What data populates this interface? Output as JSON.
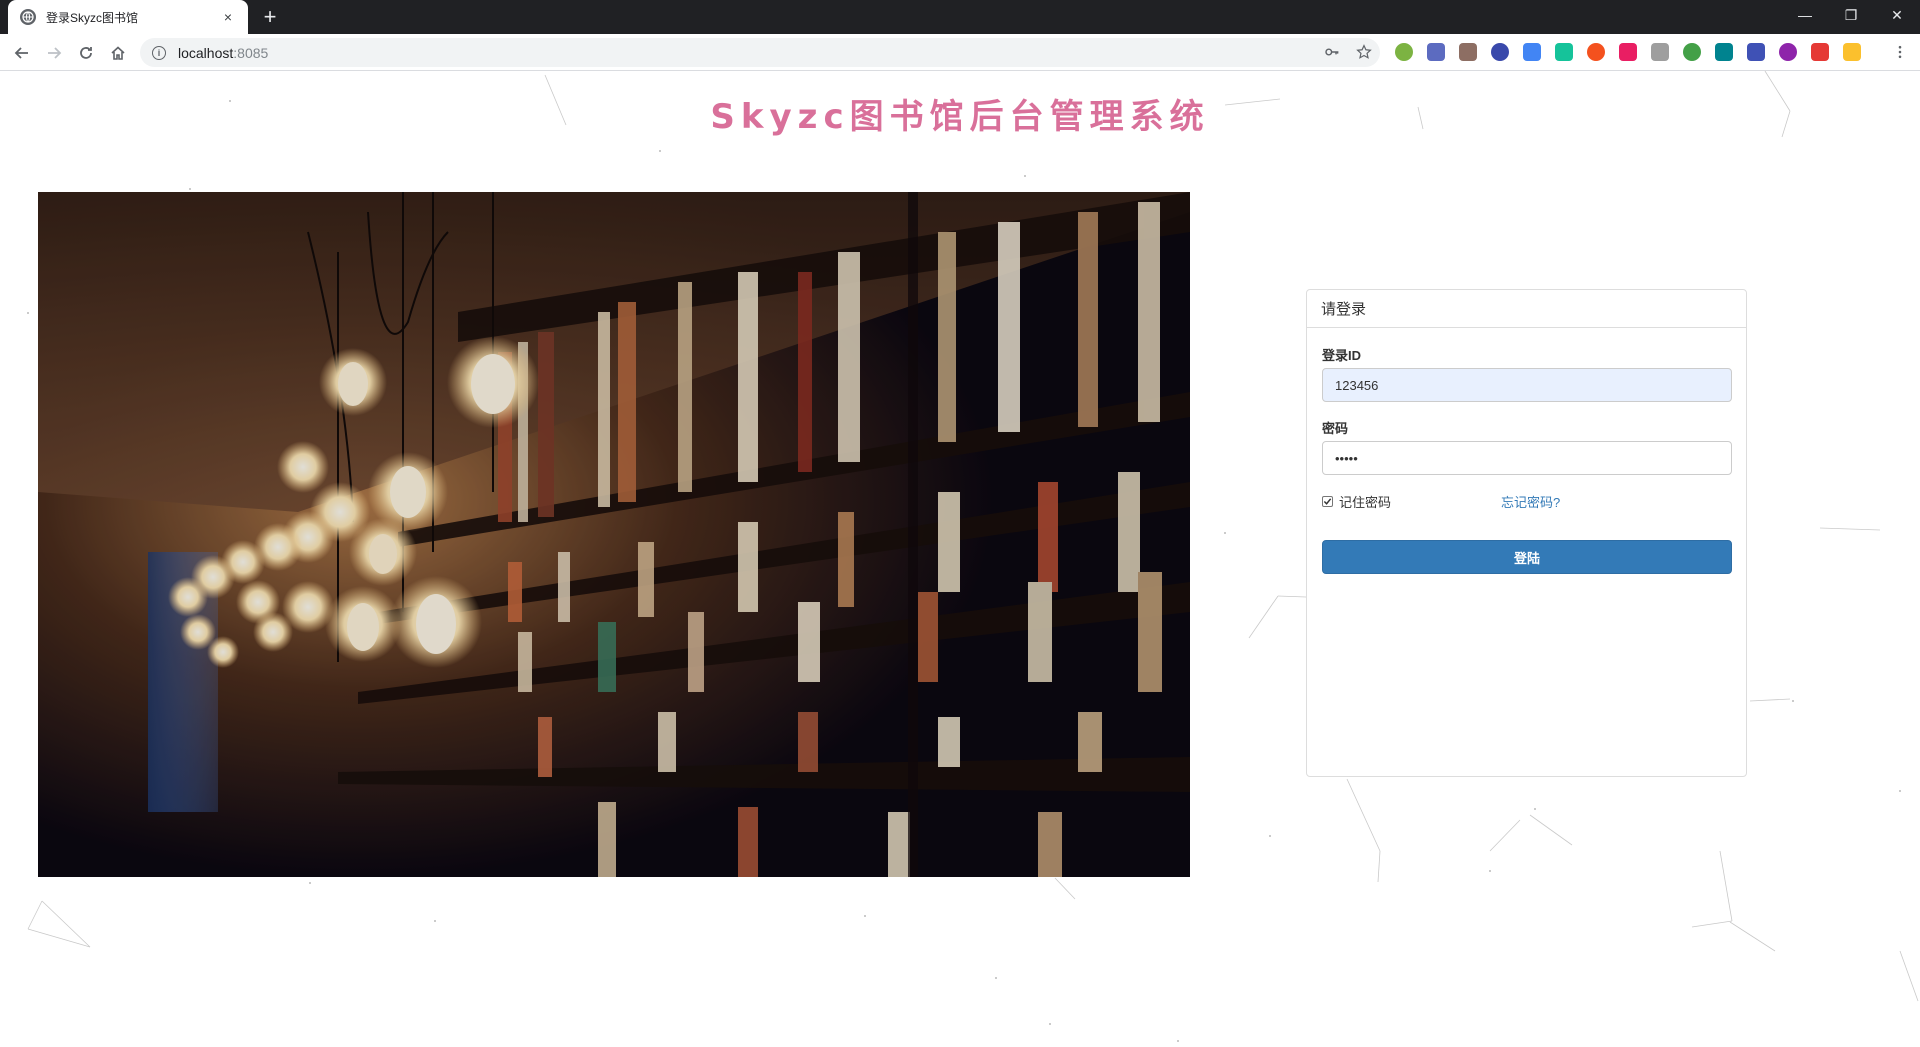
{
  "browser": {
    "tab_title": "登录Skyzc图书馆",
    "tab_close": "×",
    "new_tab": "+",
    "url_host": "localhost",
    "url_port": ":8085",
    "window_controls": {
      "minimize": "—",
      "restore": "❐",
      "close": "✕"
    },
    "extension_colors": [
      "#7cb342",
      "#5c6bc0",
      "#8d6e63",
      "#3949ab",
      "#4285f4",
      "#15c39a",
      "#f4511e",
      "#e91e63",
      "#9e9e9e",
      "#43a047",
      "#00838f",
      "#3f51b5",
      "#8e24aa",
      "#e53935",
      "#fbc02d"
    ]
  },
  "page": {
    "title": "Skyzc图书馆后台管理系统",
    "title_color": "#d9709a"
  },
  "login": {
    "heading": "请登录",
    "id_label": "登录ID",
    "id_value": "123456",
    "password_label": "密码",
    "password_value": "•••••",
    "remember_label": "记住密码",
    "remember_checked": true,
    "forgot_link": "忘记密码?",
    "submit_label": "登陆",
    "button_color": "#337ab7"
  }
}
